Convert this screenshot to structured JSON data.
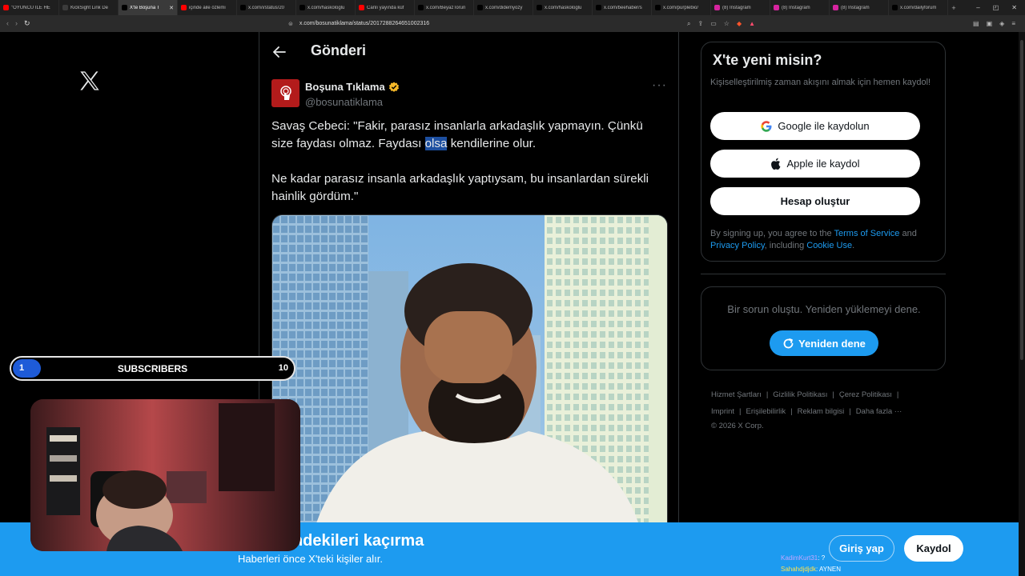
{
  "browser": {
    "tabs": [
      {
        "label": "\"OYUNCU İLE HE",
        "color": "#ff0000",
        "active": false
      },
      {
        "label": "KickSight Link De",
        "color": "#3b3b3b",
        "active": false
      },
      {
        "label": "X'te Boşuna T",
        "color": "#000000",
        "active": true
      },
      {
        "label": "içinde aile özlemi",
        "color": "#ff0000",
        "active": false
      },
      {
        "label": "x.com/i/status/20",
        "color": "#000000",
        "active": false
      },
      {
        "label": "x.com/haskologlu",
        "color": "#000000",
        "active": false
      },
      {
        "label": "Canlı yayında küf",
        "color": "#ff0000",
        "active": false
      },
      {
        "label": "x.com/BeyazTorun",
        "color": "#000000",
        "active": false
      },
      {
        "label": "x.com/didemyozy",
        "color": "#000000",
        "active": false
      },
      {
        "label": "x.com/haskologlu",
        "color": "#000000",
        "active": false
      },
      {
        "label": "x.com/beehaber/s",
        "color": "#000000",
        "active": false
      },
      {
        "label": "x.com/purplebio/",
        "color": "#000000",
        "active": false
      },
      {
        "label": "(8) Instagram",
        "color": "#d6249f",
        "active": false
      },
      {
        "label": "(8) Instagram",
        "color": "#d6249f",
        "active": false
      },
      {
        "label": "(8) Instagram",
        "color": "#d6249f",
        "active": false
      },
      {
        "label": "x.com/dailyforum",
        "color": "#000000",
        "active": false
      }
    ],
    "url": "x.com/bosunatiklama/status/2017288264651002316",
    "new_tab": "+",
    "win_min": "–",
    "win_restore": "◰",
    "win_close": "✕"
  },
  "post": {
    "header_title": "Gönderi",
    "author_name": "Boşuna Tıklama",
    "author_handle": "@bosunatiklama",
    "more": "···",
    "text_part1": "Savaş Cebeci: \"Fakir, parasız insanlarla arkadaşlık yapmayın. Çünkü size faydası olmaz. Faydası ",
    "text_highlight": "olsa",
    "text_part2": " kendilerine olur.",
    "text_paragraph2": "Ne kadar parasız insanla arkadaşlık yaptıysam, bu insanlardan sürekli hainlik gördüm.\""
  },
  "signup": {
    "title": "X'te yeni misin?",
    "subtitle": "Kişiselleştirilmiş zaman akışını almak için hemen kaydol!",
    "google_label": "Google ile kaydolun",
    "apple_label": "Apple ile kaydol",
    "create_label": "Hesap oluştur",
    "terms_prefix": "By signing up, you agree to the ",
    "terms_link": "Terms of Service",
    "terms_and": " and ",
    "privacy_link": "Privacy Policy",
    "terms_including": ", including ",
    "cookie_link": "Cookie Use",
    "terms_end": "."
  },
  "error": {
    "text": "Bir sorun oluştu. Yeniden yüklemeyi dene.",
    "retry_label": "Yeniden dene"
  },
  "footer": {
    "links": [
      "Hizmet Şartları",
      "Gizlilik Politikası",
      "Çerez Politikası",
      "Imprint",
      "Erişilebilirlik",
      "Reklam bilgisi",
      "Daha fazla ···"
    ],
    "copyright": "© 2026 X Corp."
  },
  "banner": {
    "title": "Gündemdekileri kaçırma",
    "subtitle": "Haberleri önce X'teki kişiler alır.",
    "login_label": "Giriş yap",
    "register_label": "Kaydol"
  },
  "chat": [
    {
      "user": "KadimKurt31",
      "message": ": ?",
      "color": "#c3a6ff"
    },
    {
      "user": "Sahahdjdjdk",
      "message": ": AYNEN",
      "color": "#ffe14d"
    }
  ],
  "subscriber_goal": {
    "label": "SUBSCRIBERS",
    "current": "1",
    "goal": "10",
    "progress": 0.1,
    "fill_color": "#1e5bd8"
  },
  "colors": {
    "accent": "#1d9bf0",
    "background": "#000000",
    "border": "#2f3336",
    "muted": "#71767b",
    "verified": "#f7b928"
  },
  "icons": {
    "x_logo": "x-logo-icon",
    "back": "arrow-left-icon",
    "verified": "verified-badge-icon",
    "google": "google-icon",
    "apple": "apple-icon",
    "retry": "refresh-icon"
  }
}
